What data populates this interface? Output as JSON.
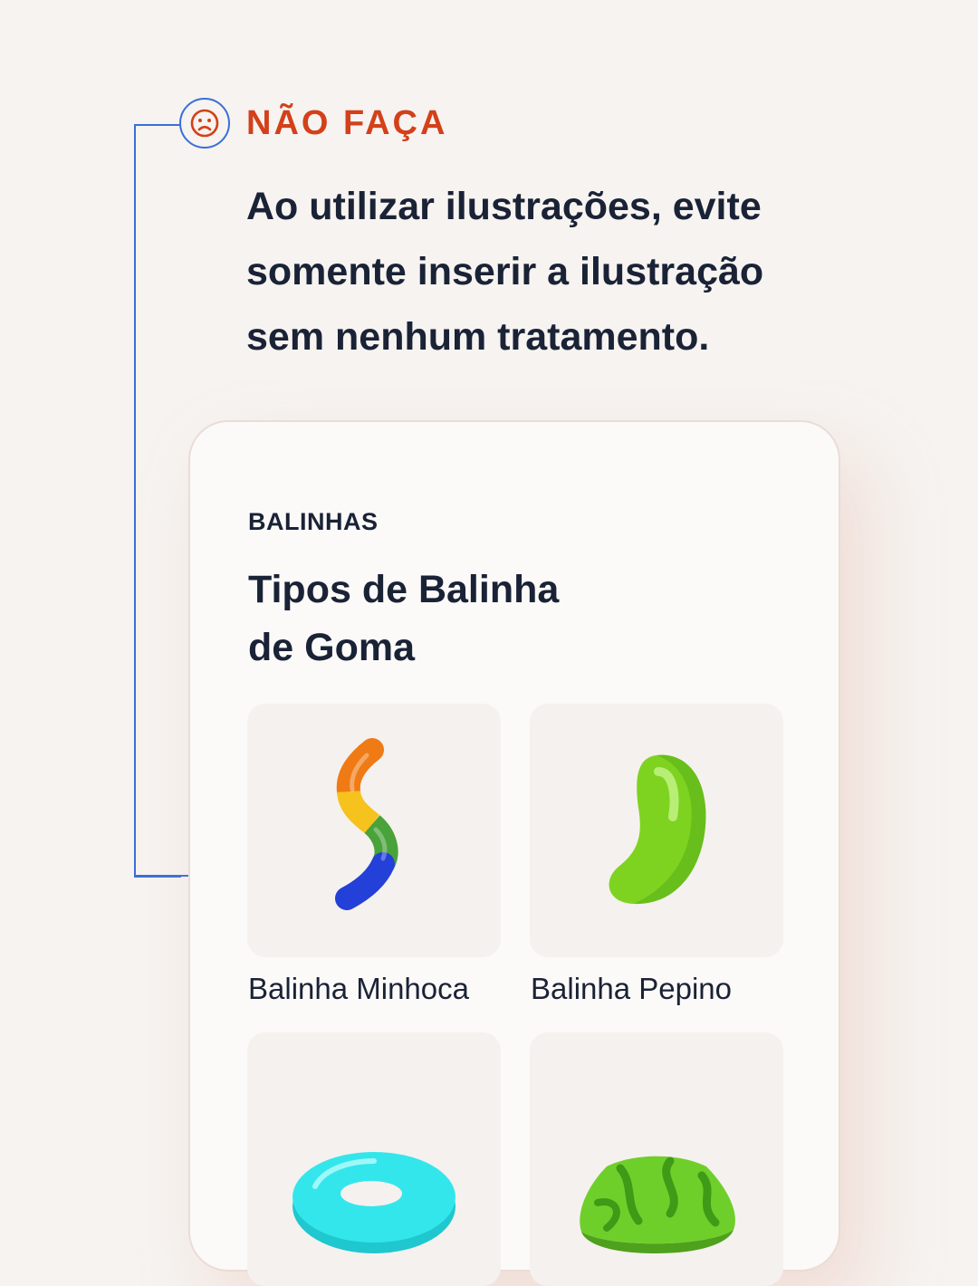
{
  "header": {
    "badge_label": "NÃO FAÇA",
    "icon": "sad-face-icon",
    "headline": "Ao utilizar ilustrações, evite somente inserir a ilustração sem nenhum tratamento."
  },
  "card": {
    "eyebrow": "BALINHAS",
    "title_line1": "Tipos de Balinha",
    "title_line2": "de Goma",
    "items": [
      {
        "label": "Balinha Minhoca",
        "icon": "gummy-worm-icon"
      },
      {
        "label": "Balinha Pepino",
        "icon": "gummy-bean-icon"
      },
      {
        "label": "",
        "icon": "gummy-ring-icon"
      },
      {
        "label": "",
        "icon": "gummy-candy-icon"
      }
    ]
  },
  "colors": {
    "background": "#f6f3f0",
    "accent_red": "#d3401a",
    "connector_blue": "#3a6fd8",
    "text_dark": "#1a2236",
    "card_bg": "#fbfaf8",
    "tile_bg": "#f5f1ee"
  }
}
